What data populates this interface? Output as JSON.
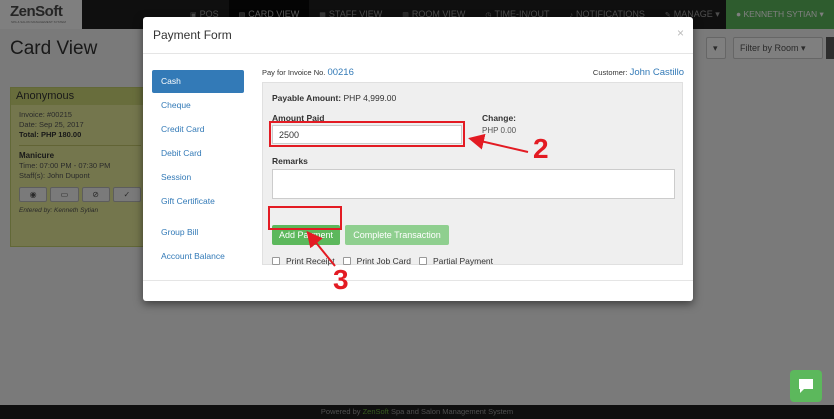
{
  "app": {
    "logo_name": "ZenSoft",
    "logo_tagline": "SPA & SALON MANAGEMENT SYSTEM",
    "nav": [
      {
        "label": "POS",
        "icon": "cart-icon"
      },
      {
        "label": "CARD VIEW",
        "icon": "cards-icon",
        "active": true
      },
      {
        "label": "STAFF VIEW",
        "icon": "users-icon"
      },
      {
        "label": "ROOM VIEW",
        "icon": "bed-icon"
      },
      {
        "label": "TIME-IN/OUT",
        "icon": "clock-icon"
      },
      {
        "label": "NOTIFICATIONS",
        "icon": "bell-icon"
      },
      {
        "label": "MANAGE ▾",
        "icon": "wrench-icon"
      }
    ],
    "user": "KENNETH SYTIAN ▾",
    "footer_prefix": "Powered by ",
    "footer_brand": "ZenSoft",
    "footer_suffix": " Spa and Salon Management System",
    "accent_color": "#5cb85c",
    "link_color": "#337ab7"
  },
  "page": {
    "title": "Card View",
    "filter_room": "Filter by Room"
  },
  "card": {
    "customer": "Anonymous",
    "invoice": "Invoice: #00215",
    "date": "Date: Sep 25, 2017",
    "total": "Total: PHP 180.00",
    "service": "Manicure",
    "time": "Time: 07:00 PM - 07:30 PM",
    "staff": "Staff(s): John Dupont",
    "entered_by": "Entered by: Kenneth Sytian"
  },
  "modal": {
    "title": "Payment Form",
    "close": "×",
    "payment_methods": [
      "Cash",
      "Cheque",
      "Credit Card",
      "Debit Card",
      "Session",
      "Gift Certificate"
    ],
    "other_methods": [
      "Group Bill",
      "Account Balance"
    ],
    "active_method": "Cash",
    "invoice_prefix": "Pay for Invoice No. ",
    "invoice_number": "00216",
    "customer_prefix": "Customer: ",
    "customer_name": "John Castillo",
    "payable_label": "Payable Amount:",
    "payable_value": " PHP 4,999.00",
    "amount_paid_label": "Amount Paid",
    "amount_paid_value": "2500",
    "change_label": "Change:",
    "change_value": "PHP 0.00",
    "remarks_label": "Remarks",
    "remarks_value": "",
    "add_payment": "Add Payment",
    "complete_transaction": "Complete Transaction",
    "options": [
      "Print Receipt",
      "Print Job Card",
      "Partial Payment"
    ]
  },
  "annotations": {
    "step_amount": "2",
    "step_add": "3",
    "color": "#e31b23"
  }
}
